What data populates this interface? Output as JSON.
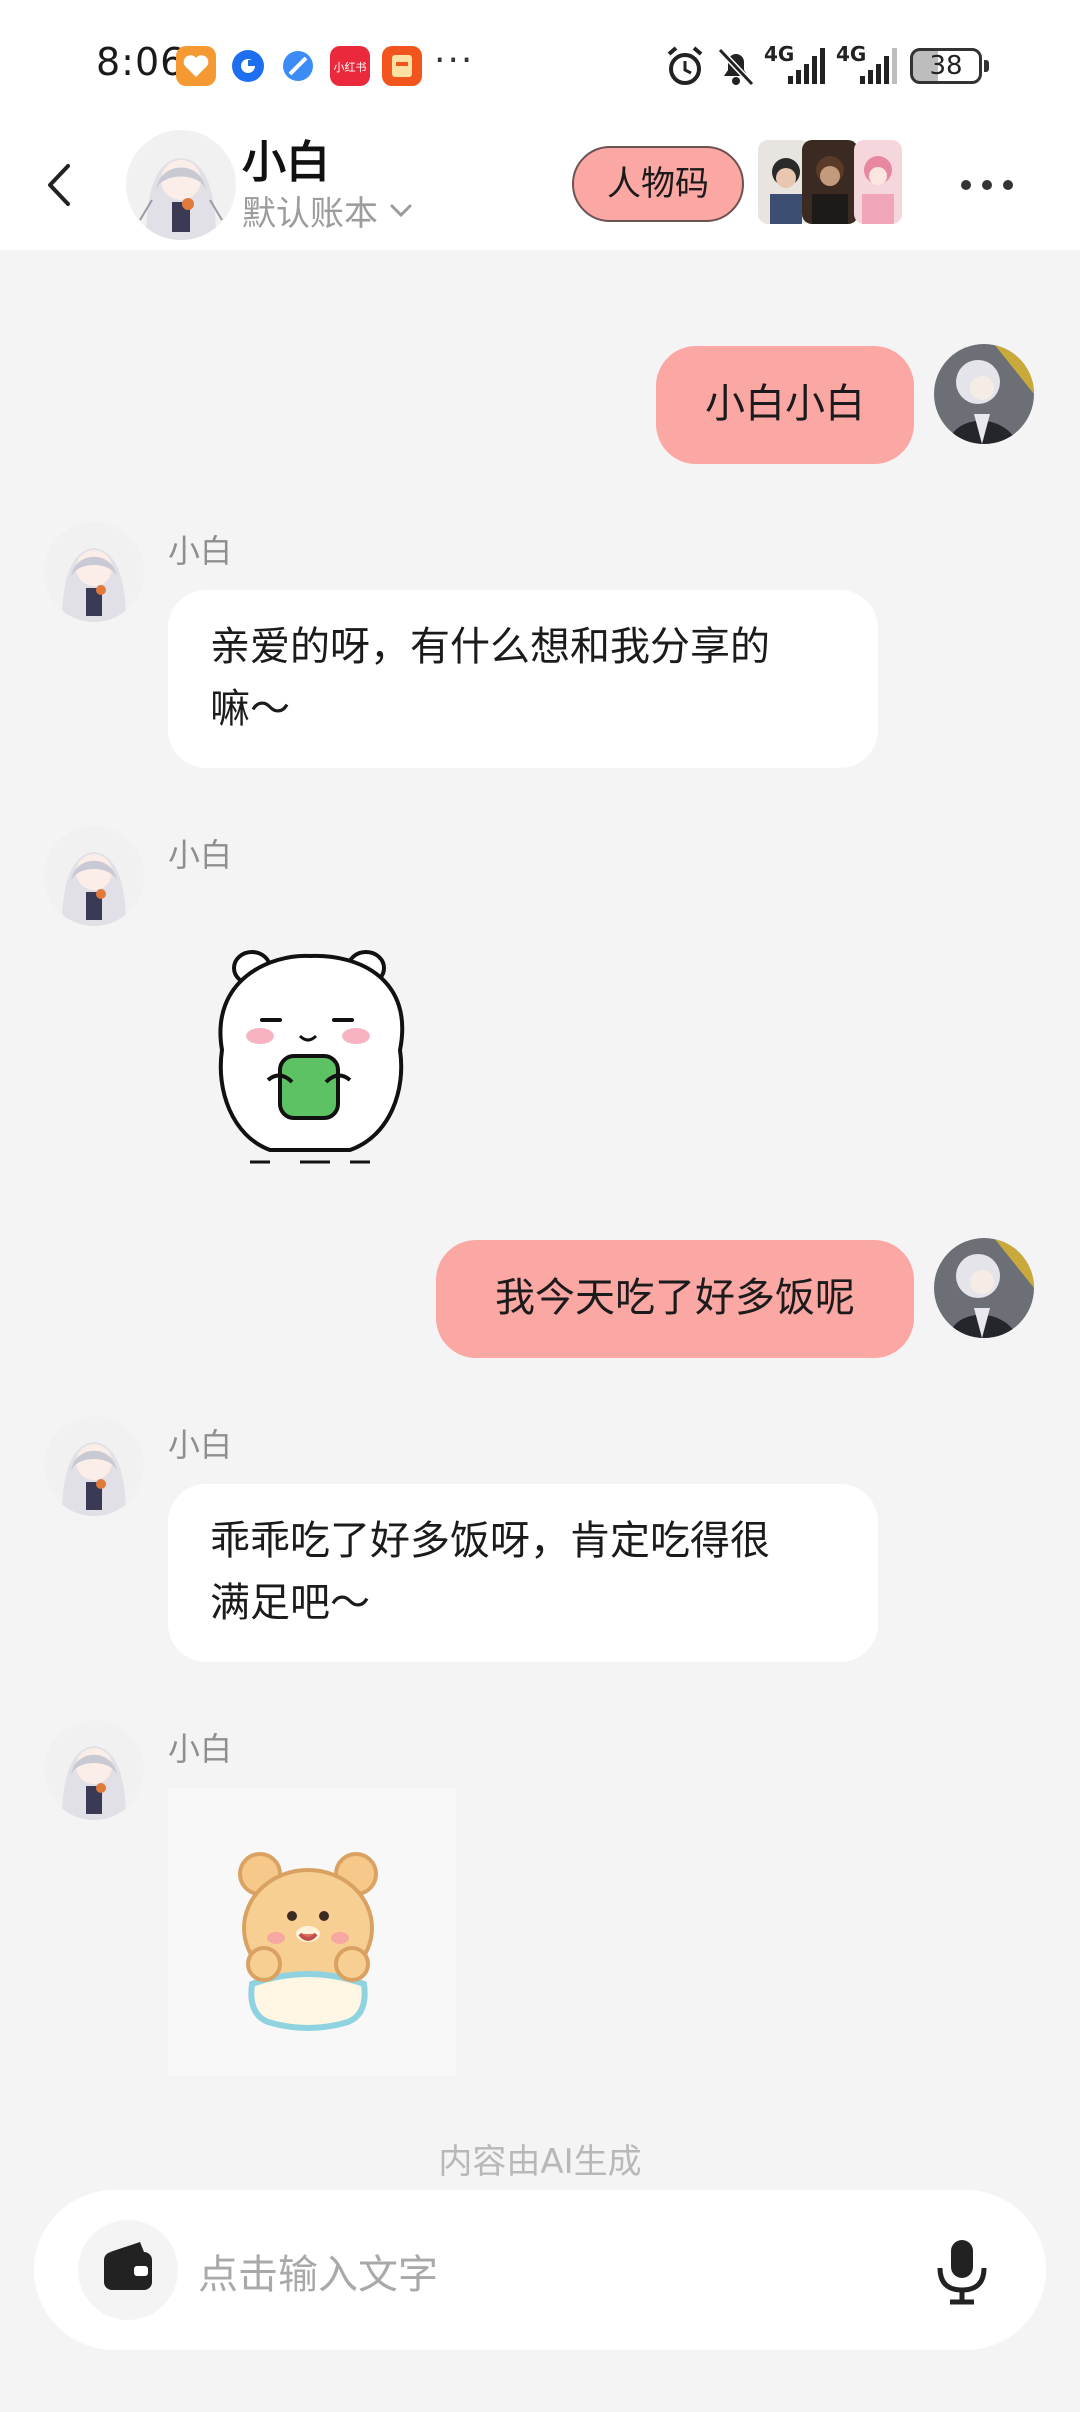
{
  "status_bar": {
    "time": "8:06",
    "battery": "38",
    "network_labels": [
      "4G",
      "4G"
    ],
    "more": "···",
    "app_icons": [
      "heart-app-icon",
      "blue-circle-app-icon",
      "blue-feather-app-icon",
      "xiaohongshu-app-icon",
      "orange-card-app-icon"
    ],
    "xiaohongshu_label": "小红书"
  },
  "header": {
    "name": "小白",
    "account": "默认账本",
    "persona_button": "人物码"
  },
  "messages": [
    {
      "side": "out",
      "text": "小白小白"
    },
    {
      "side": "in",
      "sender": "小白",
      "text_line1": "亲爱的呀，有什么想和我分享的",
      "text_line2": "嘛～"
    },
    {
      "side": "in",
      "sender": "小白",
      "sticker": "white-bear-sticker"
    },
    {
      "side": "out",
      "text": "我今天吃了好多饭呢"
    },
    {
      "side": "in",
      "sender": "小白",
      "text_line1": "乖乖吃了好多饭呀，肯定吃得很",
      "text_line2": "满足吧～"
    },
    {
      "side": "in",
      "sender": "小白",
      "sticker": "yellow-bear-sticker"
    }
  ],
  "disclaimer": "内容由AI生成",
  "input": {
    "placeholder": "点击输入文字"
  },
  "colors": {
    "accent": "#fba7a4",
    "background": "#f4f4f4",
    "bubble_in": "#ffffff"
  }
}
